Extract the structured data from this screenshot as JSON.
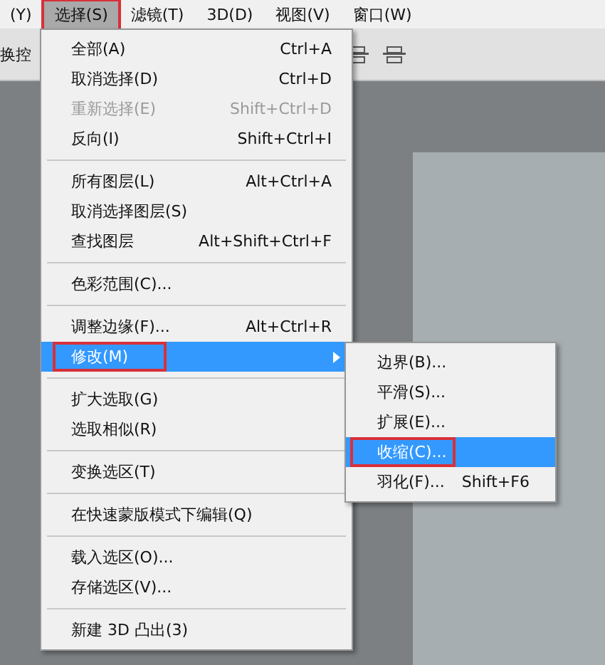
{
  "menu_bar": [
    {
      "label": "(Y)",
      "selected": false,
      "annotated": false
    },
    {
      "label": "选择(S)",
      "selected": true,
      "annotated": true
    },
    {
      "label": "滤镜(T)",
      "selected": false,
      "annotated": false
    },
    {
      "label": "3D(D)",
      "selected": false,
      "annotated": false
    },
    {
      "label": "视图(V)",
      "selected": false,
      "annotated": false
    },
    {
      "label": "窗口(W)",
      "selected": false,
      "annotated": false
    }
  ],
  "options_bar": {
    "label": "换控"
  },
  "menu": [
    {
      "kind": "item",
      "label": "全部(A)",
      "shortcut": "Ctrl+A",
      "disabled": false,
      "selected": false,
      "submenu": false,
      "annotated": false
    },
    {
      "kind": "item",
      "label": "取消选择(D)",
      "shortcut": "Ctrl+D",
      "disabled": false,
      "selected": false,
      "submenu": false,
      "annotated": false
    },
    {
      "kind": "item",
      "label": "重新选择(E)",
      "shortcut": "Shift+Ctrl+D",
      "disabled": true,
      "selected": false,
      "submenu": false,
      "annotated": false
    },
    {
      "kind": "item",
      "label": "反向(I)",
      "shortcut": "Shift+Ctrl+I",
      "disabled": false,
      "selected": false,
      "submenu": false,
      "annotated": false
    },
    {
      "kind": "separator"
    },
    {
      "kind": "item",
      "label": "所有图层(L)",
      "shortcut": "Alt+Ctrl+A",
      "disabled": false,
      "selected": false,
      "submenu": false,
      "annotated": false
    },
    {
      "kind": "item",
      "label": "取消选择图层(S)",
      "disabled": false,
      "selected": false,
      "submenu": false,
      "annotated": false
    },
    {
      "kind": "item",
      "label": "查找图层",
      "shortcut": "Alt+Shift+Ctrl+F",
      "disabled": false,
      "selected": false,
      "submenu": false,
      "annotated": false
    },
    {
      "kind": "separator"
    },
    {
      "kind": "item",
      "label": "色彩范围(C)...",
      "disabled": false,
      "selected": false,
      "submenu": false,
      "annotated": false
    },
    {
      "kind": "separator"
    },
    {
      "kind": "item",
      "label": "调整边缘(F)...",
      "shortcut": "Alt+Ctrl+R",
      "disabled": false,
      "selected": false,
      "submenu": false,
      "annotated": false
    },
    {
      "kind": "item",
      "label": "修改(M)",
      "disabled": false,
      "selected": true,
      "submenu": true,
      "annotated": true
    },
    {
      "kind": "separator"
    },
    {
      "kind": "item",
      "label": "扩大选取(G)",
      "disabled": false,
      "selected": false,
      "submenu": false,
      "annotated": false
    },
    {
      "kind": "item",
      "label": "选取相似(R)",
      "disabled": false,
      "selected": false,
      "submenu": false,
      "annotated": false
    },
    {
      "kind": "separator"
    },
    {
      "kind": "item",
      "label": "变换选区(T)",
      "disabled": false,
      "selected": false,
      "submenu": false,
      "annotated": false
    },
    {
      "kind": "separator"
    },
    {
      "kind": "item",
      "label": "在快速蒙版模式下编辑(Q)",
      "disabled": false,
      "selected": false,
      "submenu": false,
      "annotated": false
    },
    {
      "kind": "separator"
    },
    {
      "kind": "item",
      "label": "载入选区(O)...",
      "disabled": false,
      "selected": false,
      "submenu": false,
      "annotated": false
    },
    {
      "kind": "item",
      "label": "存储选区(V)...",
      "disabled": false,
      "selected": false,
      "submenu": false,
      "annotated": false
    },
    {
      "kind": "separator"
    },
    {
      "kind": "item",
      "label": "新建 3D 凸出(3)",
      "disabled": false,
      "selected": false,
      "submenu": false,
      "annotated": false
    }
  ],
  "submenu": [
    {
      "label": "边界(B)...",
      "selected": false,
      "annotated": false
    },
    {
      "label": "平滑(S)...",
      "selected": false,
      "annotated": false
    },
    {
      "label": "扩展(E)...",
      "selected": false,
      "annotated": false
    },
    {
      "label": "收缩(C)...",
      "selected": true,
      "annotated": true
    },
    {
      "label": "羽化(F)...",
      "shortcut": "Shift+F6",
      "selected": false,
      "annotated": false
    }
  ]
}
